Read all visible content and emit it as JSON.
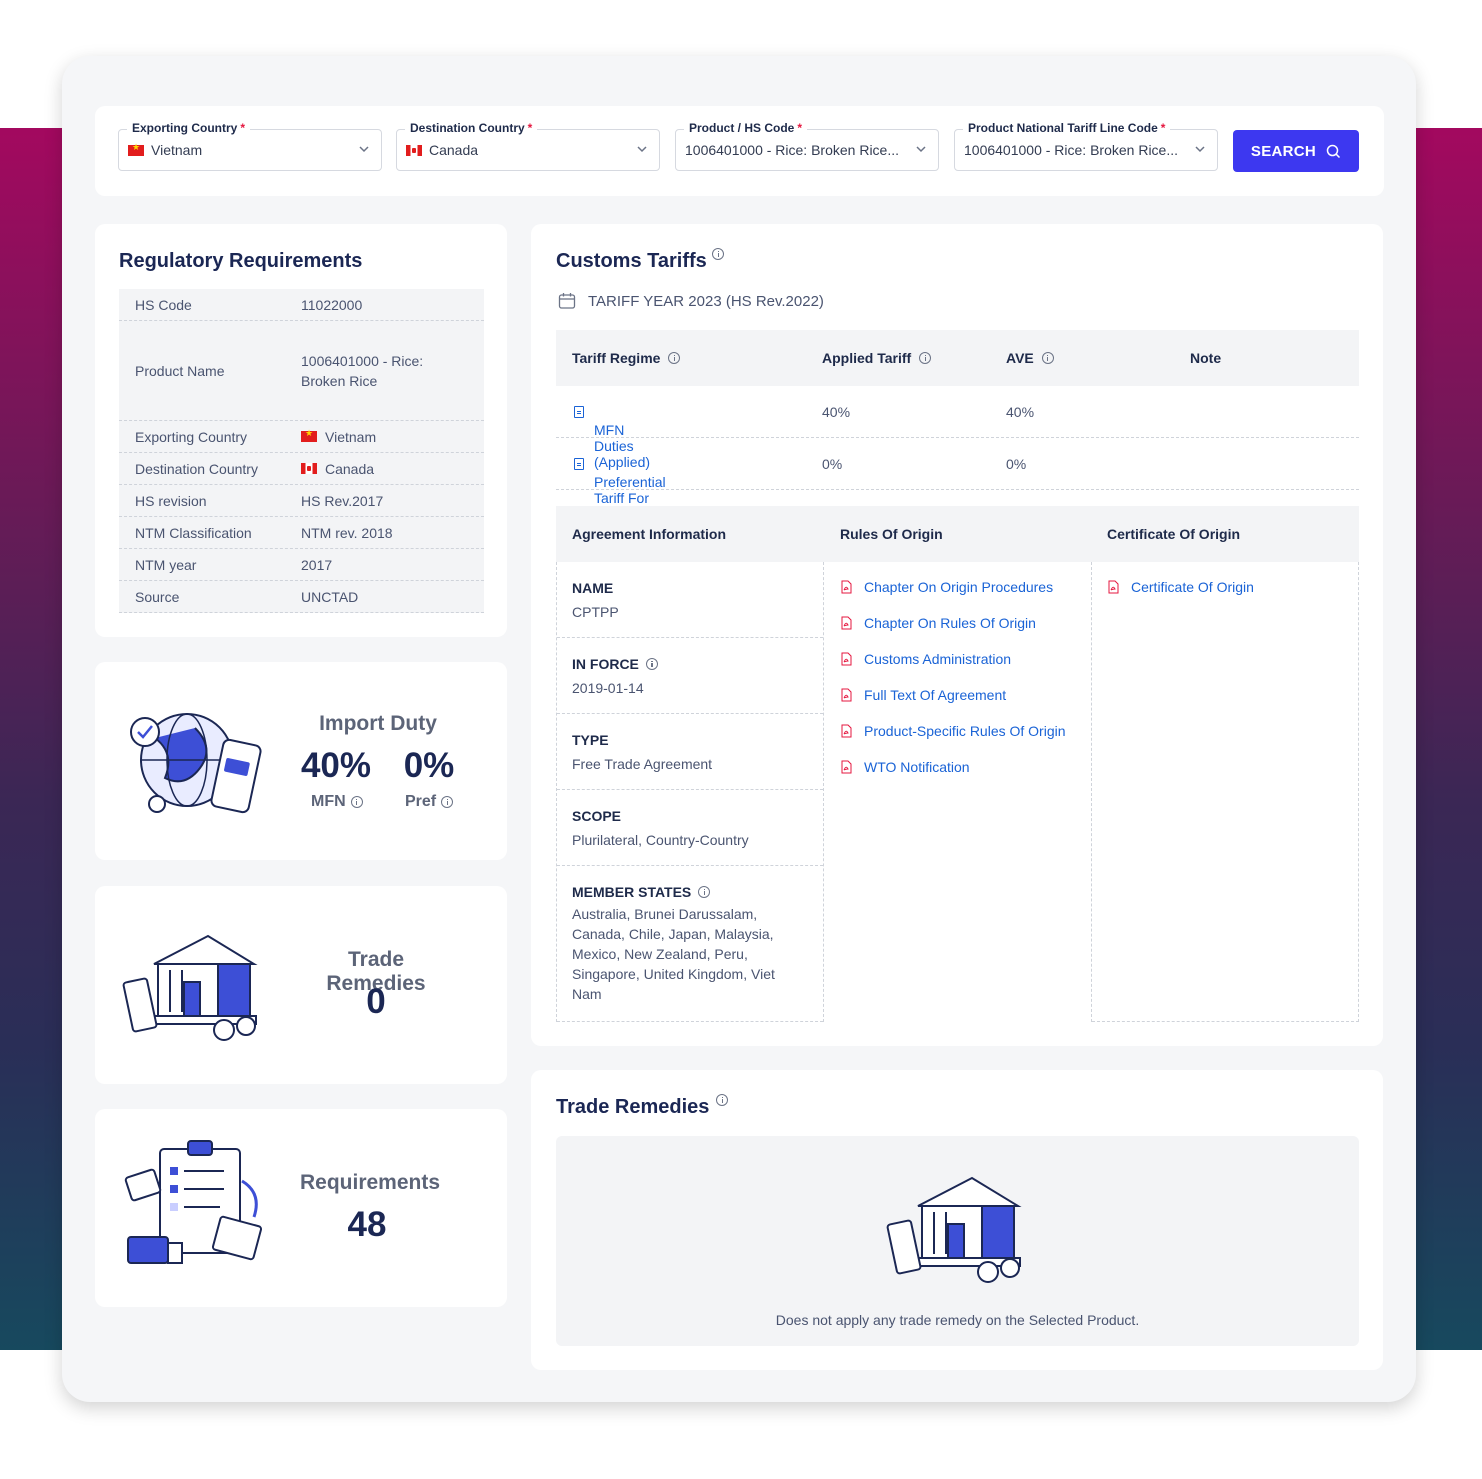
{
  "search": {
    "exporting": {
      "label": "Exporting Country",
      "required": "*",
      "value": "Vietnam"
    },
    "destination": {
      "label": "Destination Country",
      "required": "*",
      "value": "Canada"
    },
    "product": {
      "label": "Product / HS Code",
      "required": "*",
      "value": "1006401000  - Rice: Broken Rice..."
    },
    "national": {
      "label": "Product National Tariff Line Code",
      "required": "*",
      "value": "1006401000  - Rice: Broken Rice..."
    },
    "button_label": "SEARCH"
  },
  "regulatory": {
    "title": "Regulatory Requirements",
    "rows": [
      {
        "key": "HS Code",
        "value": "11022000"
      },
      {
        "key": "Product Name",
        "value": "1006401000  - Rice: Broken Rice"
      },
      {
        "key": "Exporting Country",
        "value": "Vietnam"
      },
      {
        "key": "Destination Country",
        "value": "Canada"
      },
      {
        "key": "HS revision",
        "value": "HS Rev.2017"
      },
      {
        "key": "NTM Classification",
        "value": "NTM rev. 2018"
      },
      {
        "key": "NTM year",
        "value": "2017"
      },
      {
        "key": "Source",
        "value": "UNCTAD"
      }
    ]
  },
  "import_duty": {
    "title": "Import Duty",
    "mfn_value": "40%",
    "mfn_label": "MFN",
    "pref_value": "0%",
    "pref_label": "Pref"
  },
  "trade_remedies_stat": {
    "title": "Trade Remedies",
    "value": "0"
  },
  "requirements_stat": {
    "title": "Requirements",
    "value": "48"
  },
  "customs": {
    "title": "Customs Tariffs",
    "year": "TARIFF YEAR 2023 (HS Rev.2022)",
    "headers": {
      "regime": "Tariff Regime",
      "applied": "Applied Tariff",
      "ave": "AVE",
      "note": "Note"
    },
    "rows": [
      {
        "regime": "MFN Duties (Applied)",
        "applied": "40%",
        "ave": "40%"
      },
      {
        "regime": "Preferential Tariff For Canada",
        "applied": "0%",
        "ave": "0%"
      }
    ],
    "agreement": {
      "headers": {
        "info": "Agreement Information",
        "rules": "Rules Of Origin",
        "cert": "Certificate Of Origin"
      },
      "items": [
        {
          "head": "NAME",
          "text": "CPTPP"
        },
        {
          "head": "IN FORCE",
          "text": "2019-01-14"
        },
        {
          "head": "TYPE",
          "text": "Free Trade Agreement"
        },
        {
          "head": "SCOPE",
          "text": "Plurilateral, Country-Country"
        },
        {
          "head": "MEMBER STATES",
          "text": "Australia, Brunei Darussalam, Canada, Chile, Japan, Malaysia, Mexico, New Zealand, Peru, Singapore, United Kingdom, Viet Nam"
        }
      ],
      "rules": [
        "Chapter On Origin Procedures",
        "Chapter On Rules Of Origin",
        "Customs Administration",
        "Full Text Of Agreement",
        "Product-Specific Rules Of Origin",
        "WTO Notification"
      ],
      "certificates": [
        "Certificate Of Origin"
      ]
    }
  },
  "trade_remedies": {
    "title": "Trade Remedies",
    "message": "Does not apply any trade remedy on the Selected Product."
  },
  "colors": {
    "accent": "#3d38f0",
    "link": "#1a63d6",
    "required": "#e5173f",
    "title": "#1b2754"
  }
}
